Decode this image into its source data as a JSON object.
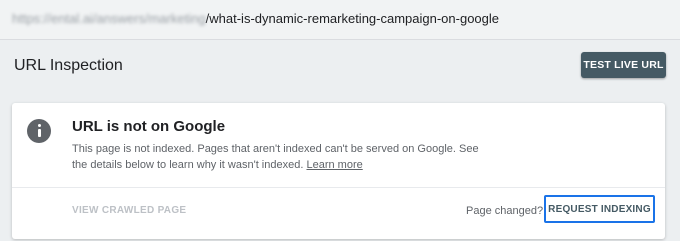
{
  "url_bar": {
    "prefix": "https://ental.ai/answers/marketing",
    "path": "/what-is-dynamic-remarketing-campaign-on-google"
  },
  "header": {
    "title": "URL Inspection",
    "test_live_label": "TEST LIVE URL"
  },
  "status_card": {
    "icon": "info-icon",
    "title": "URL is not on Google",
    "description": "This page is not indexed. Pages that aren't indexed can't be served on Google. See the details below to learn why it wasn't indexed.",
    "learn_more": "Learn more",
    "view_crawled_label": "VIEW CRAWLED PAGE",
    "page_changed_text": "Page changed?",
    "request_indexing_label": "REQUEST INDEXING"
  },
  "colors": {
    "button_bg": "#455a64",
    "focus_border": "#1a73e8",
    "background": "#eceff1"
  }
}
